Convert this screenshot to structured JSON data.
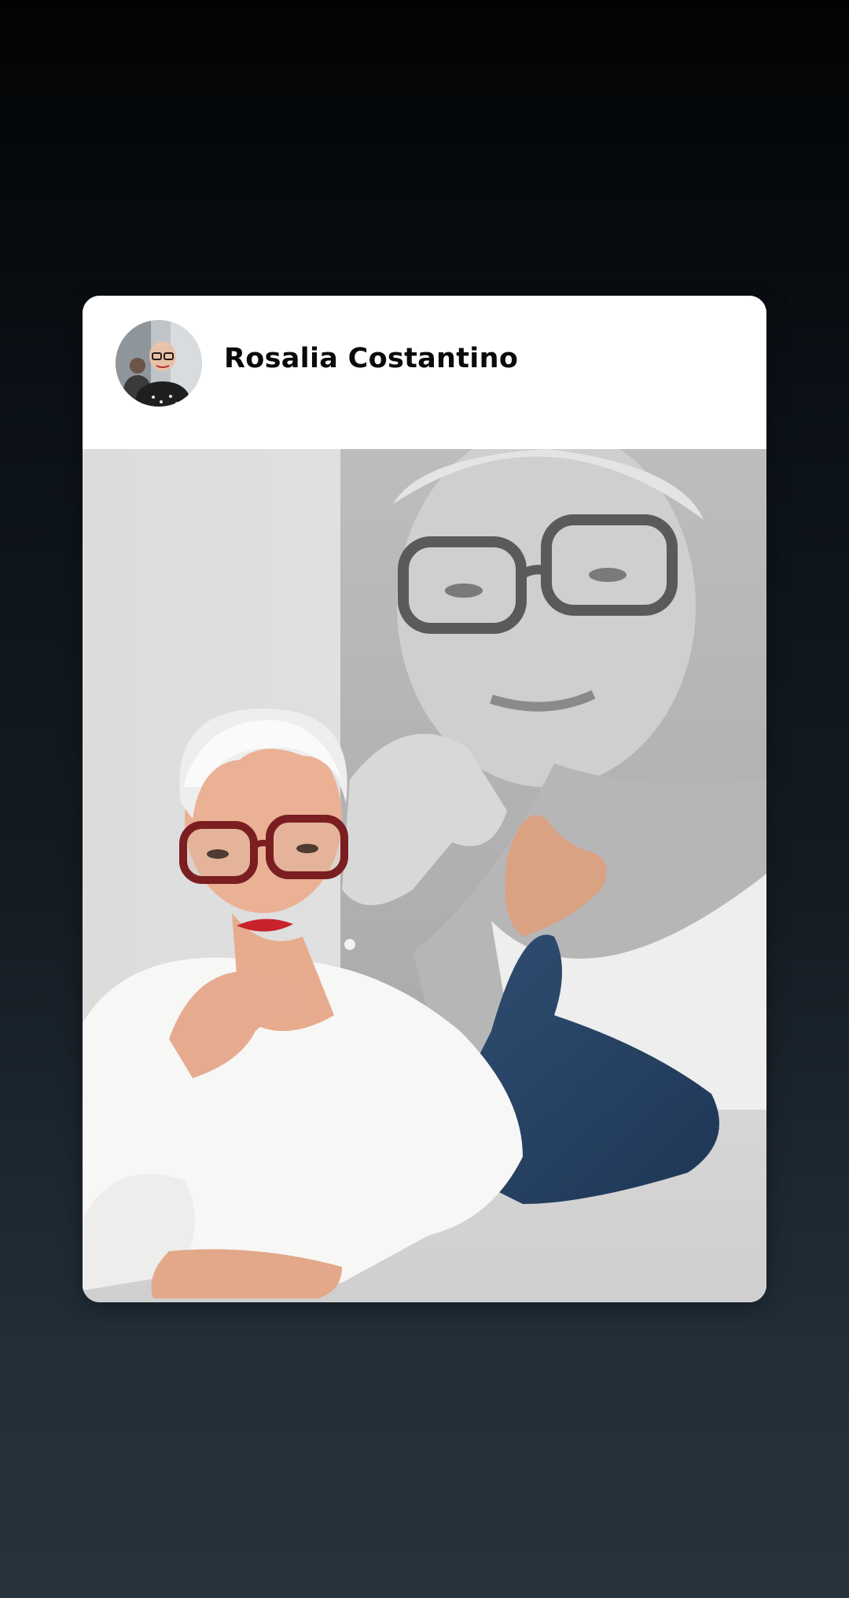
{
  "card": {
    "author_name": "Rosalia Costantino",
    "avatar_icon": "profile-avatar",
    "photo": "portrait-photo"
  },
  "colors": {
    "background_top": "#020304",
    "background_bottom": "#26333d",
    "card_bg": "#ffffff",
    "name_text": "#0a0a0a"
  }
}
